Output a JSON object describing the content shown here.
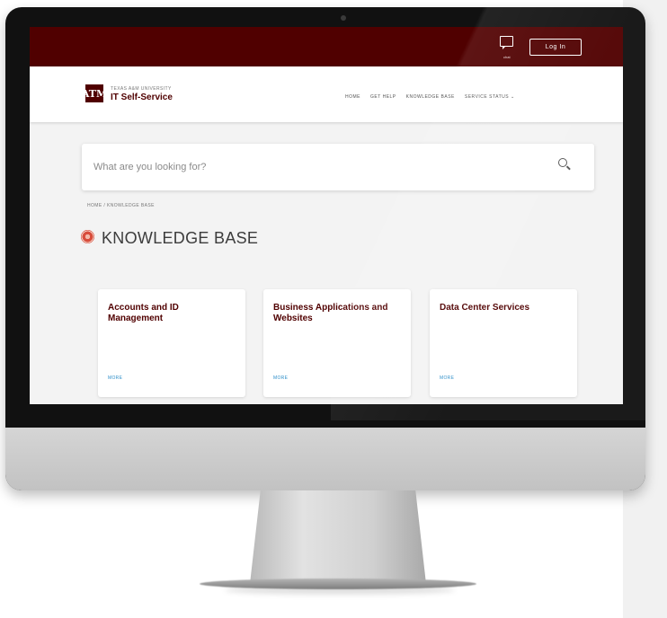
{
  "topbar": {
    "chat_caption": "chat",
    "login_label": "Log In"
  },
  "navbar": {
    "logo_text": "ATM",
    "brand_small": "TEXAS A&M UNIVERSITY",
    "brand_title": "IT Self-Service",
    "links": [
      "HOME",
      "GET HELP",
      "KNOWLEDGE BASE",
      "SERVICE STATUS ⌄"
    ]
  },
  "search": {
    "placeholder": "What are you looking for?"
  },
  "breadcrumb": "HOME / KNOWLEDGE BASE",
  "kb": {
    "title": "KNOWLEDGE BASE"
  },
  "cards": [
    {
      "title": "Accounts and ID Management",
      "more": "MORE"
    },
    {
      "title": "Business Applications and Websites",
      "more": "MORE"
    },
    {
      "title": "Data Center Services",
      "more": "MORE"
    }
  ],
  "colors": {
    "maroon": "#500000",
    "link_blue": "#2e8fc9",
    "kb_icon": "#d84d3c"
  },
  "icons": [
    "chat-icon",
    "search-icon",
    "knowledge-base-icon",
    "logo-icon"
  ]
}
